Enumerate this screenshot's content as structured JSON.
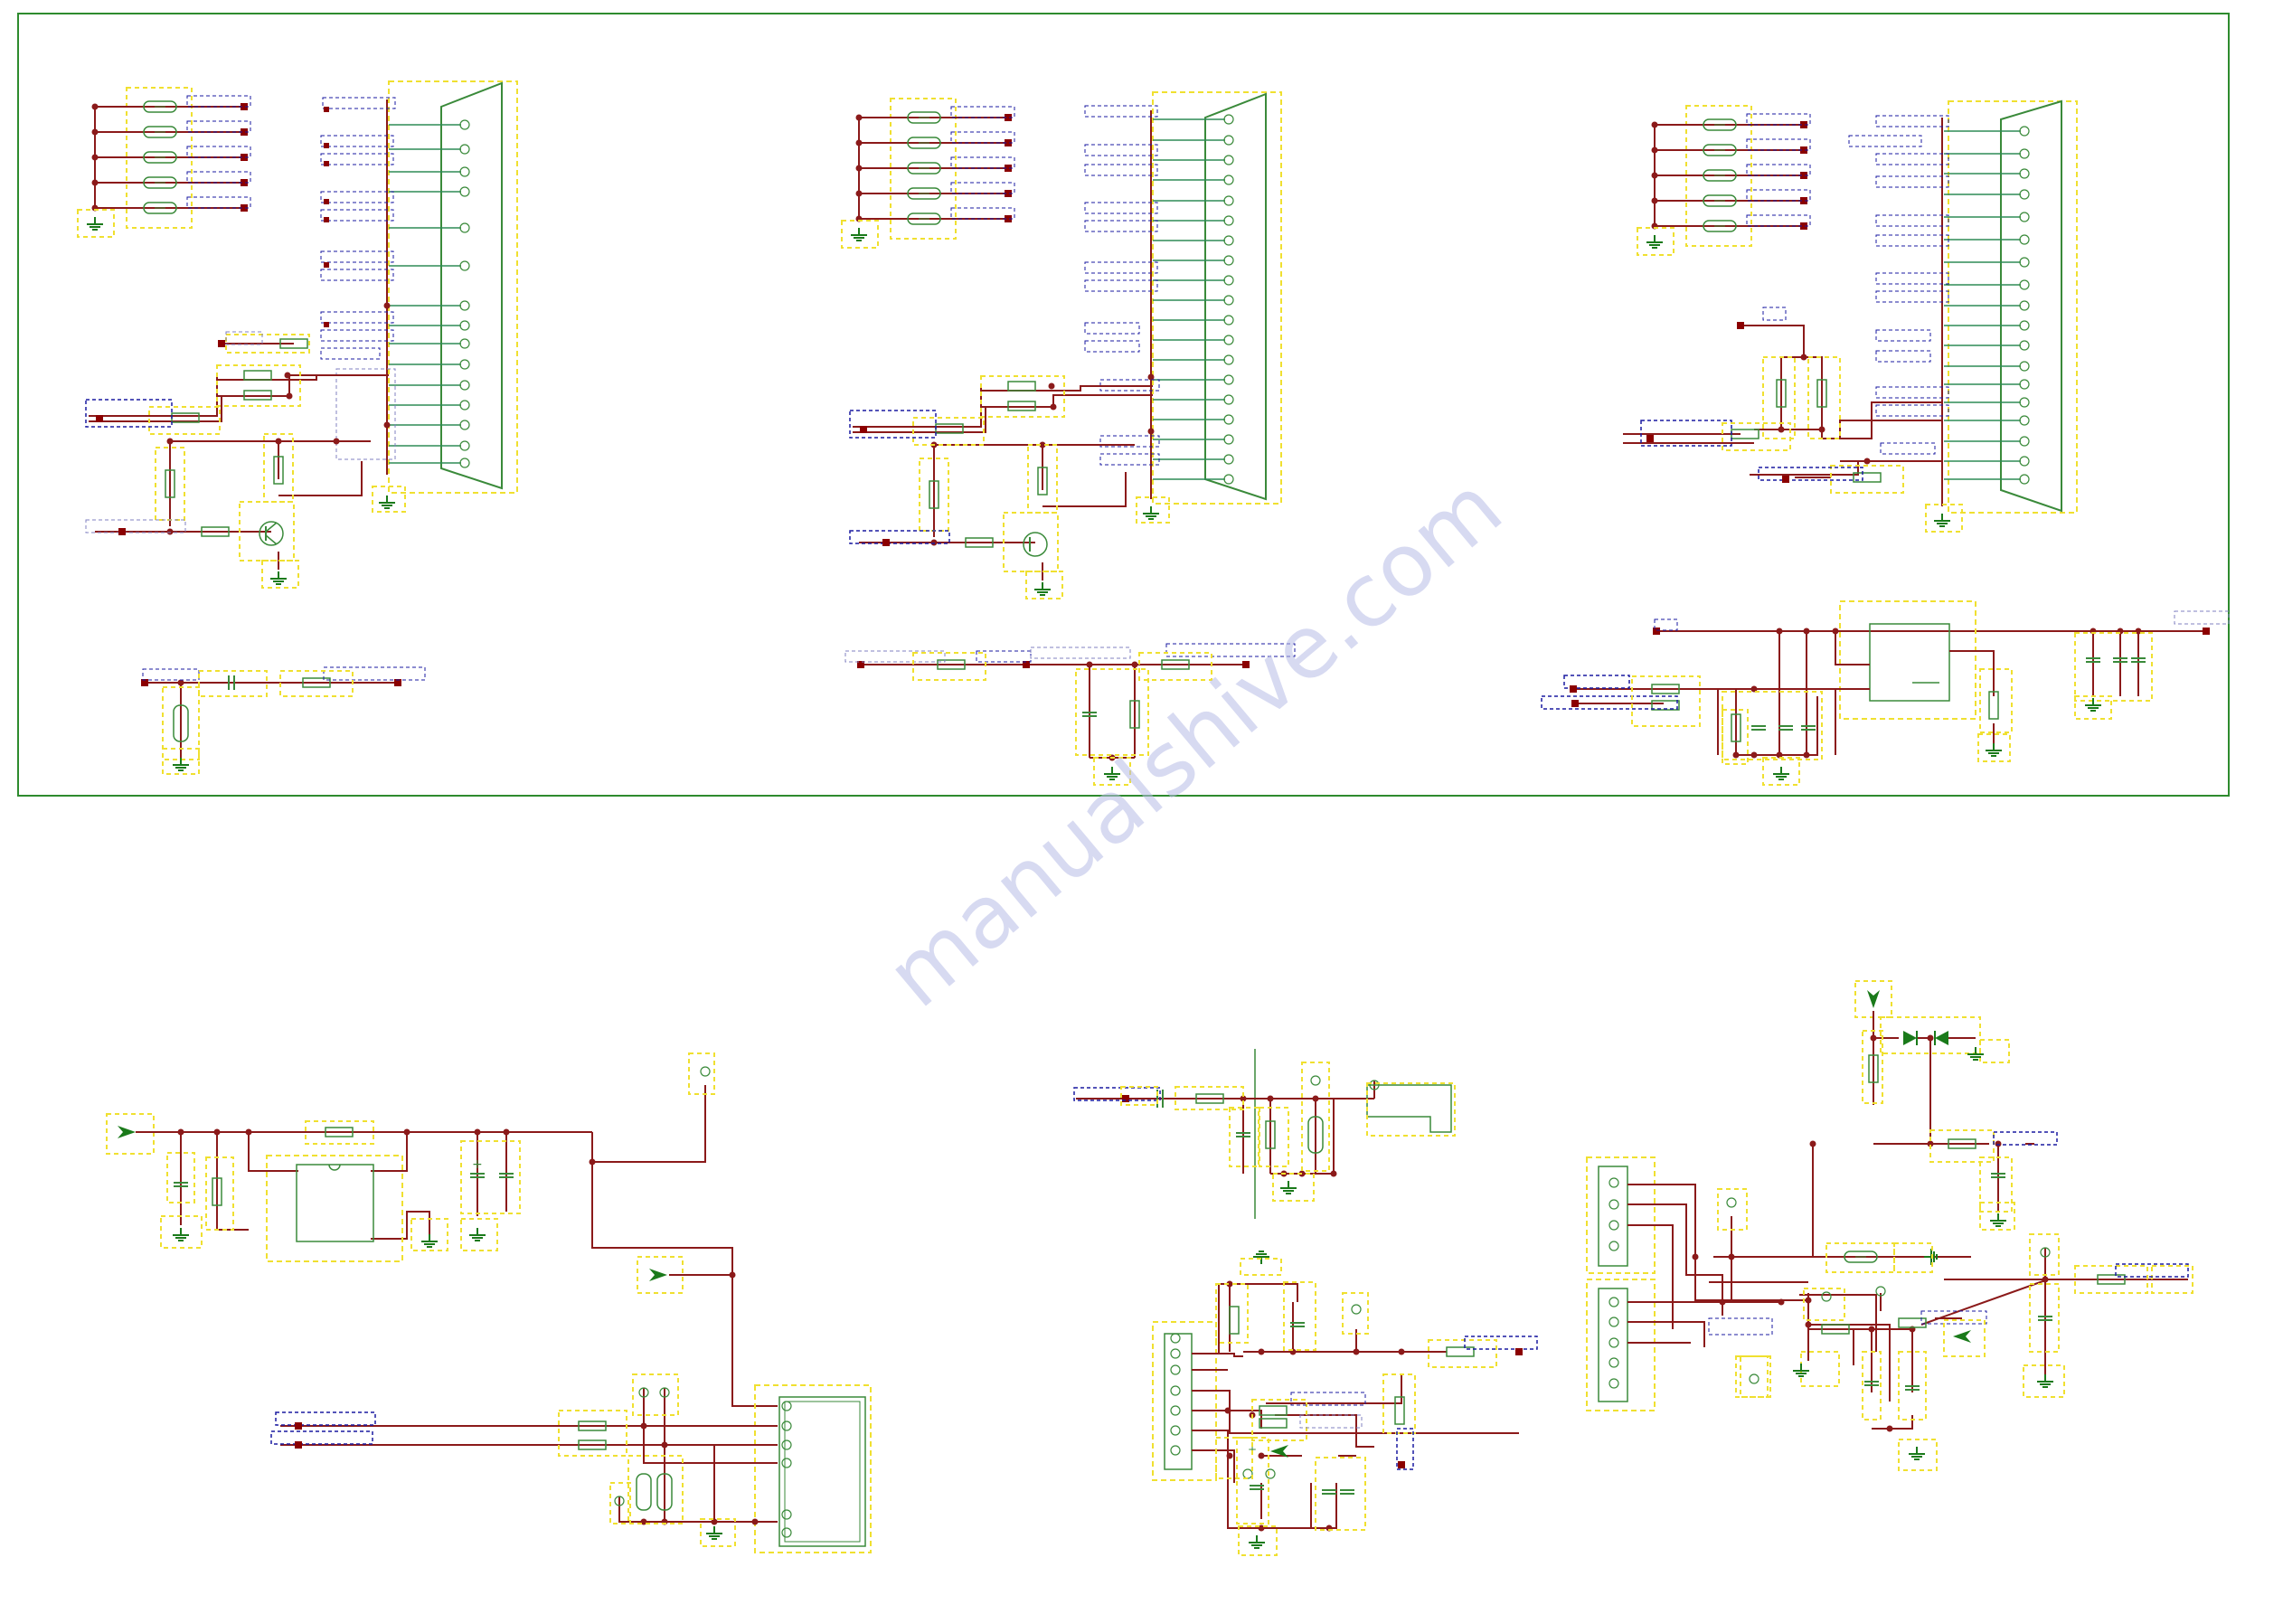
{
  "sheet": {
    "frame_color": "#2e8b2e"
  },
  "colors": {
    "wire": "#8b1a1a",
    "bus": "#2e8b57",
    "component": "#3a8a3a",
    "junction": "#8b1a1a",
    "pin": "#8b0000",
    "selection": "#f0e030",
    "net_label_box": "#1a1aa0",
    "ground": "#1a7a1a"
  },
  "watermark": {
    "text": "manualshive.com",
    "color": "#b8bde6"
  }
}
